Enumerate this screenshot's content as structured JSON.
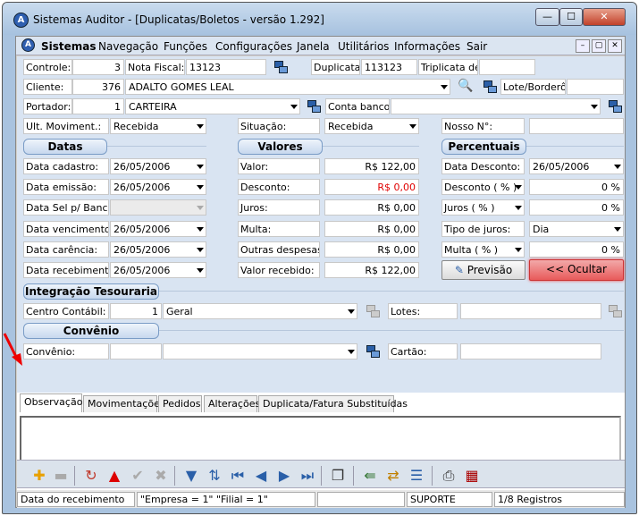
{
  "window": {
    "title": "Sistemas Auditor - [Duplicatas/Boletos - versão 1.292]",
    "min": "—",
    "max": "☐",
    "close": "✕",
    "app_icon_letter": "A"
  },
  "menu": {
    "items": [
      "Sistemas",
      "Navegação",
      "Funções",
      "Configurações",
      "Janela",
      "Utilitários",
      "Informações",
      "Sair"
    ],
    "mdi": [
      "–",
      "▢",
      "✕"
    ]
  },
  "form": {
    "controle_label": "Controle:",
    "controle_value": "3",
    "nota_label": "Nota Fiscal:",
    "nota_value": "13123",
    "duplicata_label": "Duplicata:",
    "duplicata_value": "113123",
    "triplicata_label": "Triplicata de:",
    "triplicata_value": "",
    "cliente_label": "Cliente:",
    "cliente_code": "376",
    "cliente_name": "ADALTO GOMES LEAL",
    "lote_label": "Lote/Borderô:",
    "lote_value": "",
    "portador_label": "Portador:",
    "portador_code": "1",
    "portador_name": "CARTEIRA",
    "conta_label": "Conta banco:",
    "conta_value": "",
    "ult_label": "Ult. Moviment.:",
    "ult_value": "Recebida",
    "situacao_label": "Situação:",
    "situacao_value": "Recebida",
    "nosso_label": "Nosso N°:",
    "nosso_value": "",
    "datas_header": "Datas",
    "valores_header": "Valores",
    "percentuais_header": "Percentuais",
    "data_cadastro_label": "Data cadastro:",
    "data_cadastro_value": "26/05/2006",
    "data_emissao_label": "Data emissão:",
    "data_emissao_value": "26/05/2006",
    "data_sel_label": "Data Sel p/ Banco:",
    "data_sel_value": "",
    "data_venc_label": "Data vencimento:",
    "data_venc_value": "26/05/2006",
    "data_carencia_label": "Data carência:",
    "data_carencia_value": "26/05/2006",
    "data_receb_label": "Data recebimento:",
    "data_receb_value": "26/05/2006",
    "valor_label": "Valor:",
    "valor_value": "R$ 122,00",
    "desconto_label": "Desconto:",
    "desconto_value": "R$ 0,00",
    "juros_label": "Juros:",
    "juros_value": "R$ 0,00",
    "multa_label": "Multa:",
    "multa_value": "R$ 0,00",
    "outras_label": "Outras despesas:",
    "outras_value": "R$ 0,00",
    "valor_rec_label": "Valor recebido:",
    "valor_rec_value": "R$ 122,00",
    "data_desc_label": "Data Desconto:",
    "data_desc_value": "26/05/2006",
    "desc_pct_label": "Desconto ( % )",
    "desc_pct_value": "0 %",
    "juros_pct_label": "Juros ( % )",
    "juros_pct_value": "0 %",
    "tipo_juros_label": "Tipo de juros:",
    "tipo_juros_value": "Dia",
    "multa_pct_label": "Multa ( % )",
    "multa_pct_value": "0 %",
    "previsao_label": "Previsão",
    "ocultar_label": "<< Ocultar",
    "integracao_header": "Integração Tesouraria",
    "centro_label": "Centro Contábil:",
    "centro_code": "1",
    "centro_name": "Geral",
    "lotes_label": "Lotes:",
    "lotes_value": "",
    "convenio_header": "Convênio",
    "convenio_label": "Convênio:",
    "convenio_code": "",
    "convenio_name": "",
    "cartao_label": "Cartão:",
    "cartao_value": ""
  },
  "tabs": [
    "Observação",
    "Movimentações",
    "Pedidos",
    "Alterações",
    "Duplicata/Fatura Substituídas"
  ],
  "toolbar": {
    "icons": [
      "add-icon",
      "remove-icon",
      "refresh-icon",
      "warning-icon",
      "check-icon",
      "cancel-icon",
      "filter-icon",
      "sort-icon",
      "first-icon",
      "prev-icon",
      "next-icon",
      "last-icon",
      "copy-icon",
      "import-icon",
      "transfer-icon",
      "list-icon",
      "print-icon",
      "calendar-icon"
    ]
  },
  "status": {
    "field": "Data do recebimento",
    "company": "\"Empresa = 1\"   \"Filial = 1\"",
    "blank": "",
    "user": "SUPORTE",
    "records": "1/8 Registros"
  },
  "colors": {
    "accent": "#2f5fb0",
    "desconto_red": "#e00000",
    "ocultar_bg": "#e85a5a"
  }
}
